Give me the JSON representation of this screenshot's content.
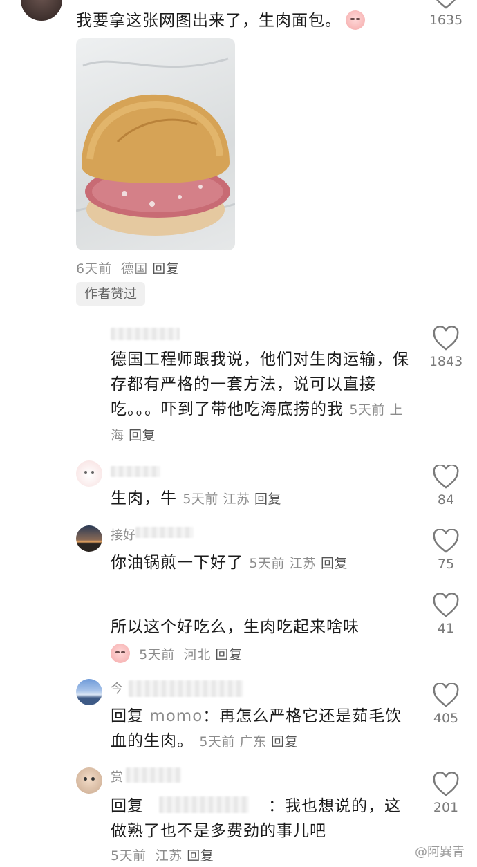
{
  "top_comment": {
    "text": "我要拿这张网图出来了，生肉面包。",
    "likes": "1635",
    "meta_time": "6天前",
    "meta_location": "德国",
    "reply_label": "回复",
    "author_liked_badge": "作者赞过"
  },
  "replies": [
    {
      "text": "德国工程师跟我说，他们对生肉运输，保存都有严格的一套方法，说可以直接吃。。。吓到了带他吃海底捞的我",
      "time": "5天前",
      "location": "上海",
      "reply_label": "回复",
      "likes": "1843"
    },
    {
      "text": "生肉，牛",
      "time": "5天前",
      "location": "江苏",
      "reply_label": "回复",
      "likes": "84"
    },
    {
      "name": "接好",
      "text": "你油锅煎一下好了",
      "time": "5天前",
      "location": "江苏",
      "reply_label": "回复",
      "likes": "75"
    },
    {
      "text": "所以这个好吃么，生肉吃起来啥味",
      "time": "5天前",
      "location": "河北",
      "reply_label": "回复",
      "likes": "41"
    },
    {
      "name": "今",
      "reply_prefix": "回复",
      "reply_to": "momo",
      "text": "：再怎么严格它还是茹毛饮血的生肉。",
      "time": "5天前",
      "location": "广东",
      "reply_label": "回复",
      "likes": "405"
    },
    {
      "name": "赏",
      "reply_prefix": "回复",
      "text": "：我也想说的，这做熟了也不是多费劲的事儿吧",
      "time": "5天前",
      "location": "江苏",
      "reply_label": "回复",
      "likes": "201"
    }
  ],
  "watermark": "@阿巽青",
  "icons": {
    "like": "heart-outline-icon"
  },
  "colors": {
    "meta": "#8c8c8c",
    "text": "#1b1b1b",
    "badge_bg": "#f0f0f0"
  }
}
